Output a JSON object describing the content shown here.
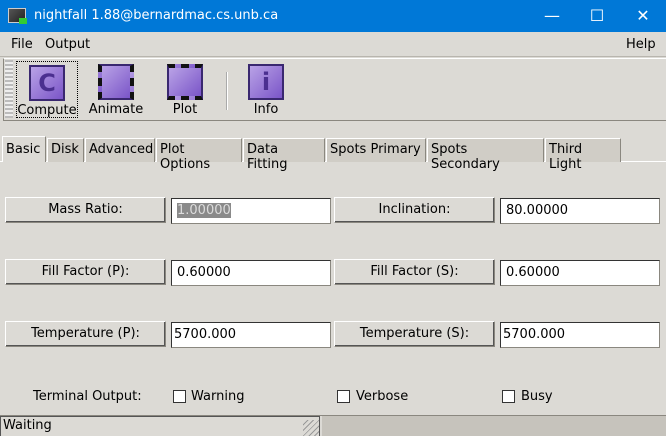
{
  "window": {
    "title": "nightfall  1.88@bernardmac.cs.unb.ca",
    "minimize": "—",
    "maximize": "☐",
    "close": "✕"
  },
  "menu": {
    "file": "File",
    "output": "Output",
    "help": "Help"
  },
  "toolbar": {
    "compute": "Compute",
    "animate": "Animate",
    "plot": "Plot",
    "info": "Info",
    "compute_glyph": "C",
    "info_glyph": "i"
  },
  "tabs": [
    "Basic",
    "Disk",
    "Advanced",
    "Plot Options",
    "Data Fitting",
    "Spots Primary",
    "Spots Secondary",
    "Third Light"
  ],
  "fields": {
    "mass_ratio": {
      "label": "Mass Ratio:",
      "value": "1.00000"
    },
    "inclination": {
      "label": "Inclination:",
      "value": "80.00000"
    },
    "fill_p": {
      "label": "Fill Factor (P):",
      "value": "0.60000"
    },
    "fill_s": {
      "label": "Fill Factor (S):",
      "value": "0.60000"
    },
    "temp_p": {
      "label": "Temperature (P):",
      "value": "5700.000"
    },
    "temp_s": {
      "label": "Temperature (S):",
      "value": "5700.000"
    }
  },
  "terminal": {
    "label": "Terminal Output:",
    "warning": "Warning",
    "verbose": "Verbose",
    "busy": "Busy"
  },
  "status": "Waiting"
}
